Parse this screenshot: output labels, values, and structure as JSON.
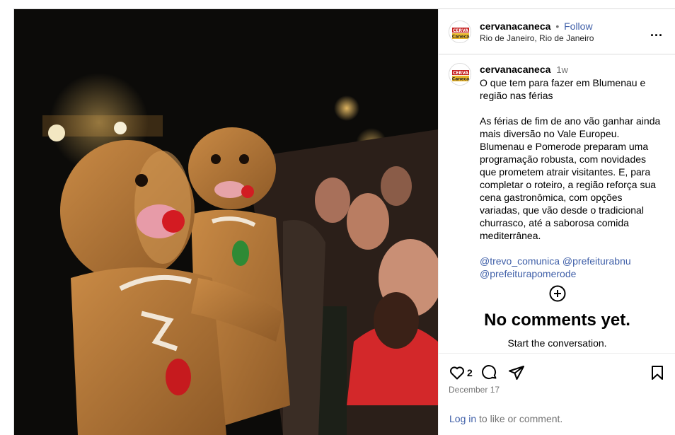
{
  "post": {
    "author": "cervanacaneca",
    "follow_label": "Follow",
    "separator": "•",
    "location": "Rio de Janeiro, Rio de Janeiro",
    "more_icon": "more-horizontal-icon",
    "more_label": "...",
    "caption": {
      "author": "cervanacaneca",
      "time": "1w",
      "title": "O que tem para fazer em Blumenau e região nas férias",
      "body": "As férias de fim de ano vão ganhar ainda mais diversão no Vale Europeu. Blumenau e Pomerode preparam uma programação robusta, com novidades que prometem atrair visitantes. E, para completar o roteiro, a região reforça sua cena gastronômica, com opções variadas, que vão desde o tradicional churrasco, até a saborosa comida mediterrânea.",
      "tags": "@trevo_comunica @prefeiturabnu @prefeiturapomerode"
    },
    "comments": {
      "empty_title": "No comments yet.",
      "empty_subtitle": "Start the conversation."
    },
    "likes": "2",
    "date": "December 17",
    "login_link": "Log in",
    "login_text": " to like or comment."
  },
  "colors": {
    "link": "#3f5fa8",
    "muted": "#737373",
    "border": "#dbdbdb"
  }
}
